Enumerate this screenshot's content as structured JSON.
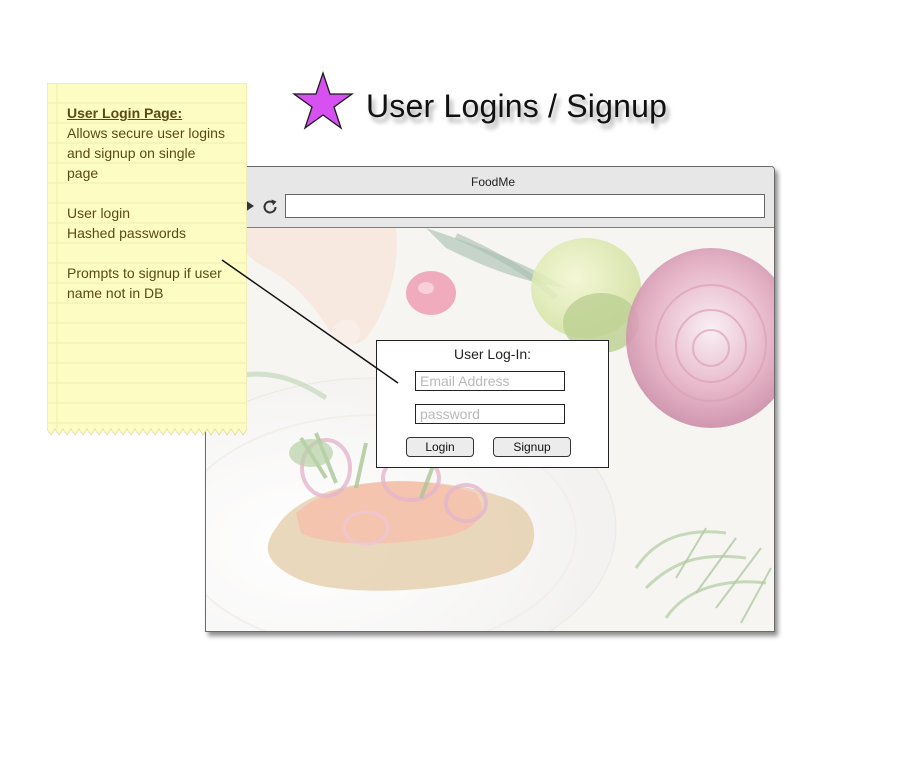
{
  "header": {
    "title": "User Logins / Signup",
    "star_color": "#d651f0"
  },
  "browser": {
    "title": "FoodMe",
    "address_value": "",
    "hero_image": "fresh food photo (smoked salmon toast with herbs, onions, limes)"
  },
  "login_panel": {
    "heading": "User Log-In:",
    "email_placeholder": "Email Address",
    "password_placeholder": "password",
    "login_label": "Login",
    "signup_label": "Signup"
  },
  "sticky_note": {
    "title": "User Login Page:",
    "lines": [
      "Allows secure user logins",
      "and signup on single",
      "page",
      "",
      "User login",
      "Hashed passwords",
      "",
      "Prompts to signup if user",
      "name not in DB"
    ],
    "color": "#fdfdc3"
  }
}
